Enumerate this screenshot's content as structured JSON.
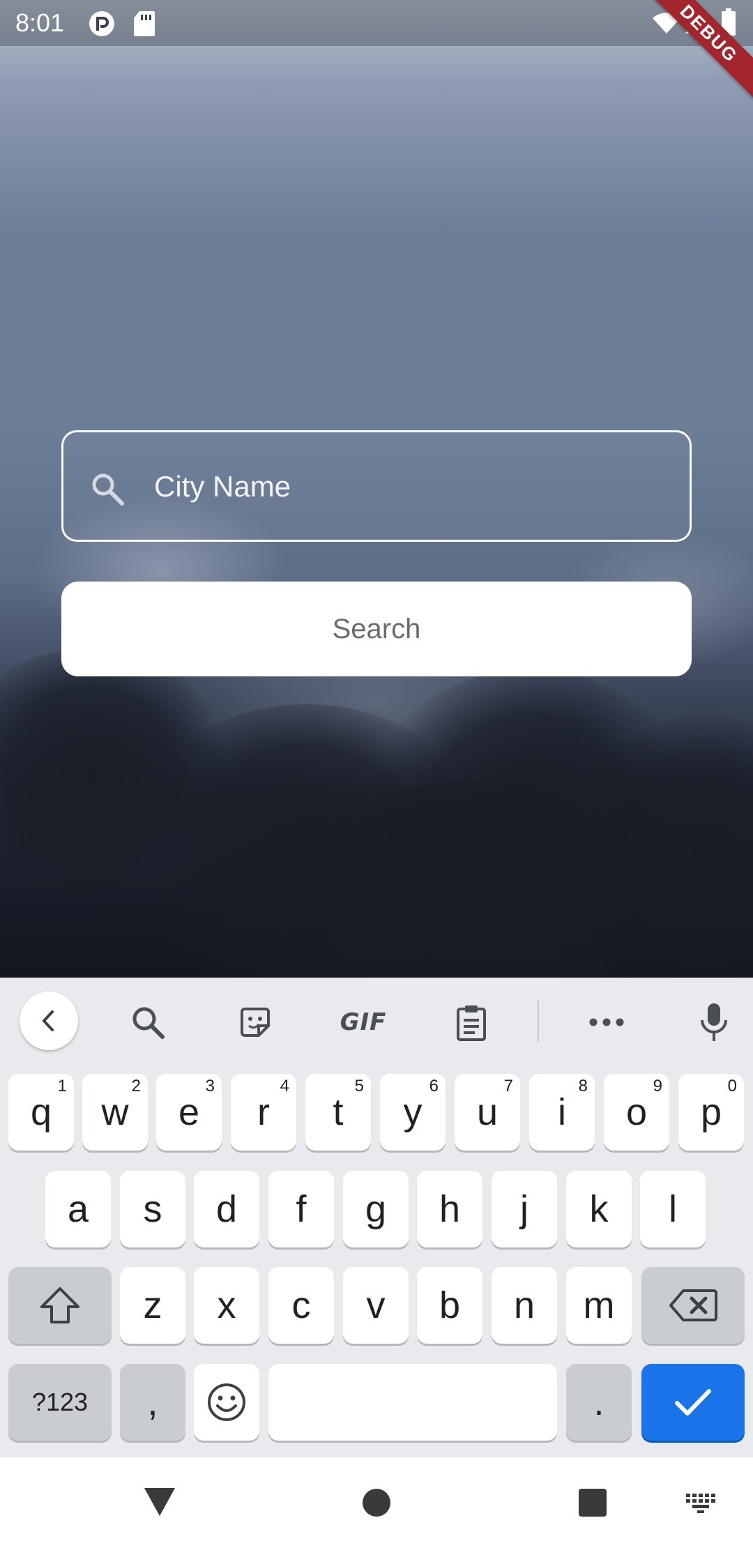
{
  "status_bar": {
    "time": "8:01",
    "icons": [
      "notification-app-icon",
      "sd-card-icon",
      "wifi-icon",
      "signal-icon",
      "battery-icon"
    ],
    "debug_label": "DEBUG"
  },
  "search_form": {
    "city_placeholder": "City Name",
    "city_value": "",
    "search_label": "Search"
  },
  "keyboard": {
    "toolbar": [
      "back-icon",
      "search-icon",
      "sticker-icon",
      "gif-icon",
      "clipboard-icon",
      "more-icon",
      "microphone-icon"
    ],
    "gif_label": "GIF",
    "row1": [
      {
        "key": "q",
        "hint": "1"
      },
      {
        "key": "w",
        "hint": "2"
      },
      {
        "key": "e",
        "hint": "3"
      },
      {
        "key": "r",
        "hint": "4"
      },
      {
        "key": "t",
        "hint": "5"
      },
      {
        "key": "y",
        "hint": "6"
      },
      {
        "key": "u",
        "hint": "7"
      },
      {
        "key": "i",
        "hint": "8"
      },
      {
        "key": "o",
        "hint": "9"
      },
      {
        "key": "p",
        "hint": "0"
      }
    ],
    "row2": [
      "a",
      "s",
      "d",
      "f",
      "g",
      "h",
      "j",
      "k",
      "l"
    ],
    "row3": [
      "z",
      "x",
      "c",
      "v",
      "b",
      "n",
      "m"
    ],
    "symbols_label": "?123",
    "comma_label": ",",
    "period_label": ".",
    "space_label": ""
  },
  "nav_bar": {
    "items": [
      "back-triangle-icon",
      "home-circle-icon",
      "recents-square-icon",
      "keyboard-switch-icon"
    ]
  },
  "colors": {
    "accent_blue": "#1a73e8",
    "debug_red": "#a3262d",
    "keyboard_bg": "#e8eaed"
  }
}
